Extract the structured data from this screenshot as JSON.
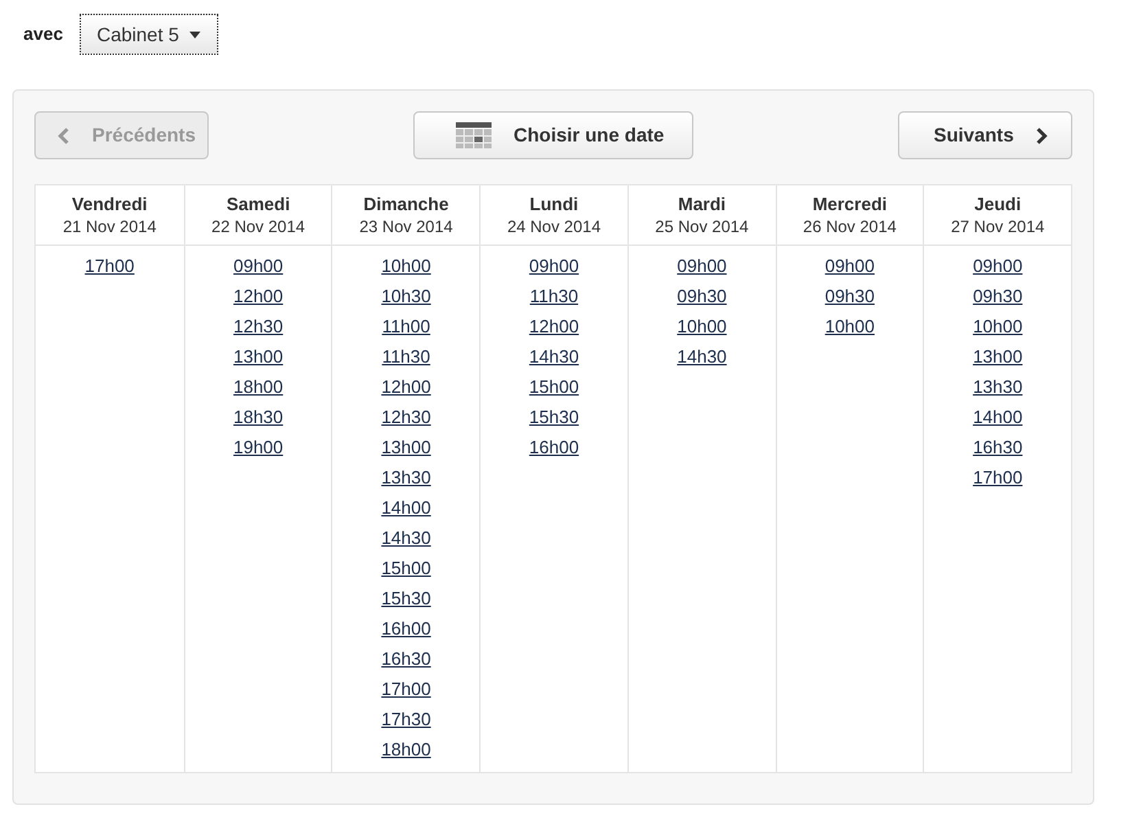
{
  "filter": {
    "label": "avec",
    "dropdown": "Cabinet 5"
  },
  "nav": {
    "previous": {
      "label": "Précédents",
      "disabled": true
    },
    "pick_date": {
      "label": "Choisir une date"
    },
    "next": {
      "label": "Suivants",
      "disabled": false
    }
  },
  "days": [
    {
      "name": "Vendredi",
      "date": "21 Nov 2014",
      "slots": [
        "17h00"
      ]
    },
    {
      "name": "Samedi",
      "date": "22 Nov 2014",
      "slots": [
        "09h00",
        "12h00",
        "12h30",
        "13h00",
        "18h00",
        "18h30",
        "19h00"
      ]
    },
    {
      "name": "Dimanche",
      "date": "23 Nov 2014",
      "slots": [
        "10h00",
        "10h30",
        "11h00",
        "11h30",
        "12h00",
        "12h30",
        "13h00",
        "13h30",
        "14h00",
        "14h30",
        "15h00",
        "15h30",
        "16h00",
        "16h30",
        "17h00",
        "17h30",
        "18h00"
      ]
    },
    {
      "name": "Lundi",
      "date": "24 Nov 2014",
      "slots": [
        "09h00",
        "11h30",
        "12h00",
        "14h30",
        "15h00",
        "15h30",
        "16h00"
      ]
    },
    {
      "name": "Mardi",
      "date": "25 Nov 2014",
      "slots": [
        "09h00",
        "09h30",
        "10h00",
        "14h30"
      ]
    },
    {
      "name": "Mercredi",
      "date": "26 Nov 2014",
      "slots": [
        "09h00",
        "09h30",
        "10h00"
      ]
    },
    {
      "name": "Jeudi",
      "date": "27 Nov 2014",
      "slots": [
        "09h00",
        "09h30",
        "10h00",
        "13h00",
        "13h30",
        "14h00",
        "16h30",
        "17h00"
      ]
    }
  ]
}
